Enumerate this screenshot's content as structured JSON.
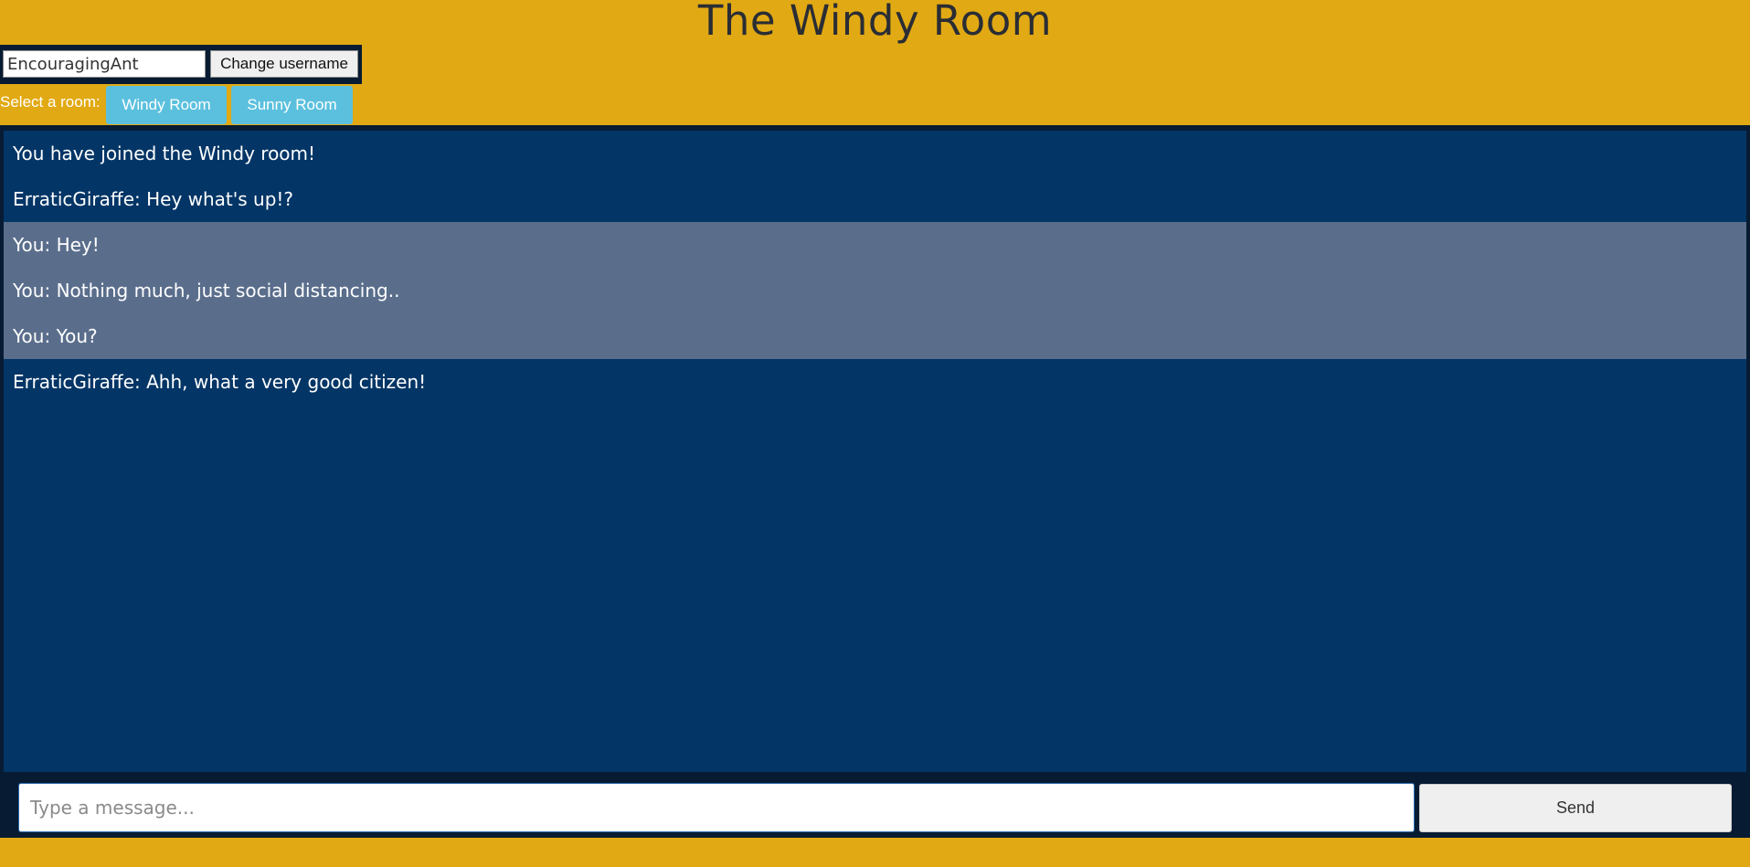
{
  "header": {
    "title": "The Windy Room"
  },
  "user": {
    "username_value": "EncouragingAnt",
    "change_username_label": "Change username"
  },
  "rooms": {
    "label": "Select a room:",
    "buttons": [
      "Windy Room",
      "Sunny Room"
    ]
  },
  "messages": [
    {
      "text": "You have joined the Windy room!",
      "own": false
    },
    {
      "text": "ErraticGiraffe: Hey what's up!?",
      "own": false
    },
    {
      "text": "You: Hey!",
      "own": true
    },
    {
      "text": "You: Nothing much, just social distancing..",
      "own": true
    },
    {
      "text": "You: You?",
      "own": true
    },
    {
      "text": "ErraticGiraffe: Ahh, what a very good citizen!",
      "own": false
    }
  ],
  "compose": {
    "placeholder": "Type a message...",
    "send_label": "Send"
  },
  "colors": {
    "background": "#e1a913",
    "panel_dark": "#071c33",
    "messages_bg": "#033566",
    "own_message_bg": "#5a6e8c",
    "room_button": "#5bc0de"
  }
}
